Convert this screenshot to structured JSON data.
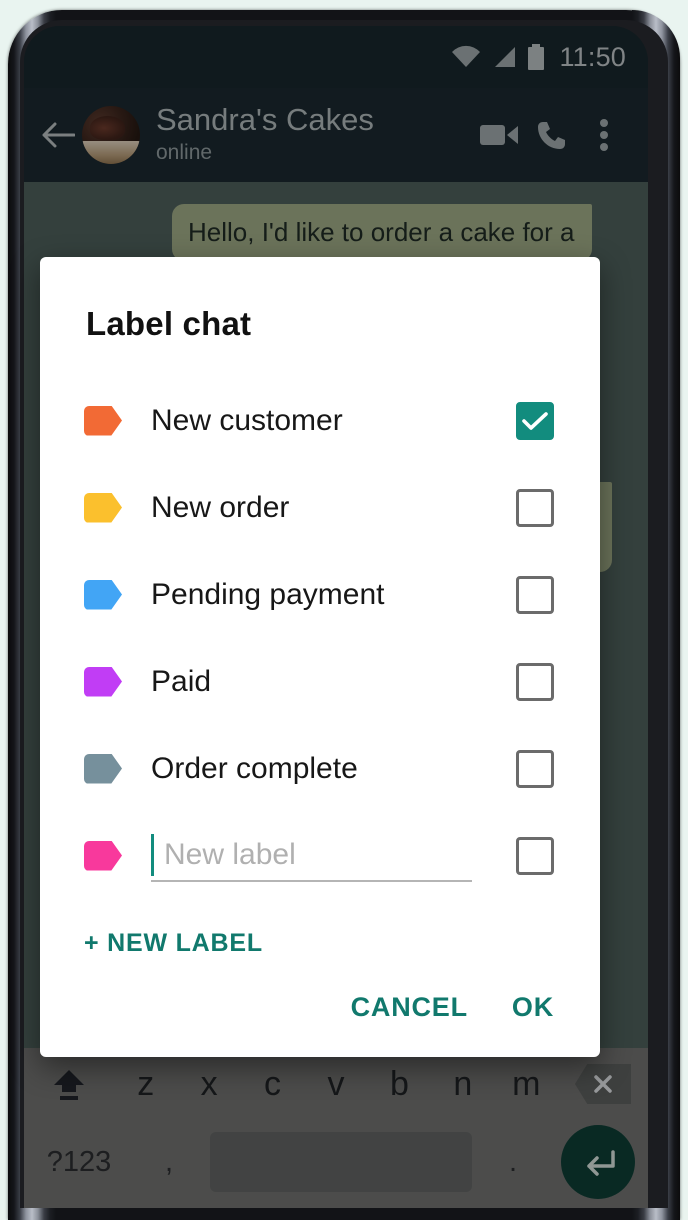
{
  "status_bar": {
    "time": "11:50",
    "icons": [
      "wifi-icon",
      "cellular-signal-icon",
      "battery-icon"
    ]
  },
  "chat_header": {
    "back_icon": "back-arrow-icon",
    "avatar": "contact-avatar",
    "title": "Sandra's Cakes",
    "subtitle": "online",
    "actions": [
      "video-call-icon",
      "voice-call-icon",
      "overflow-menu-icon"
    ]
  },
  "chat_body": {
    "messages": [
      {
        "text": "Hello, I'd like to order a cake for a",
        "direction": "in"
      },
      {
        "text": "",
        "direction": "in"
      },
      {
        "text": "",
        "direction": "in"
      },
      {
        "text": "",
        "direction": "in"
      },
      {
        "text": "",
        "direction": "out"
      },
      {
        "text": "",
        "direction": "in"
      }
    ]
  },
  "keyboard": {
    "shift_key": "shift-icon",
    "letters": [
      "z",
      "x",
      "c",
      "v",
      "b",
      "n",
      "m"
    ],
    "backspace_key": "backspace-icon",
    "numeric_key": "?123",
    "comma_key": ",",
    "space_key": "",
    "period_key": ".",
    "enter_key": "enter-icon"
  },
  "dialog": {
    "title": "Label chat",
    "labels": [
      {
        "name": "New customer",
        "color": "#f26a35",
        "checked": true
      },
      {
        "name": "New order",
        "color": "#fbc02d",
        "checked": false
      },
      {
        "name": "Pending payment",
        "color": "#42a5f5",
        "checked": false
      },
      {
        "name": "Paid",
        "color": "#c13df5",
        "checked": false
      },
      {
        "name": "Order complete",
        "color": "#76909c",
        "checked": false
      }
    ],
    "new_label": {
      "color": "#f8399c",
      "placeholder": "New label",
      "value": "",
      "checked": false
    },
    "new_label_action": "+ NEW LABEL",
    "cancel_label": "CANCEL",
    "ok_label": "OK",
    "accent_color": "#11796d",
    "checked_color": "#128c7e"
  }
}
